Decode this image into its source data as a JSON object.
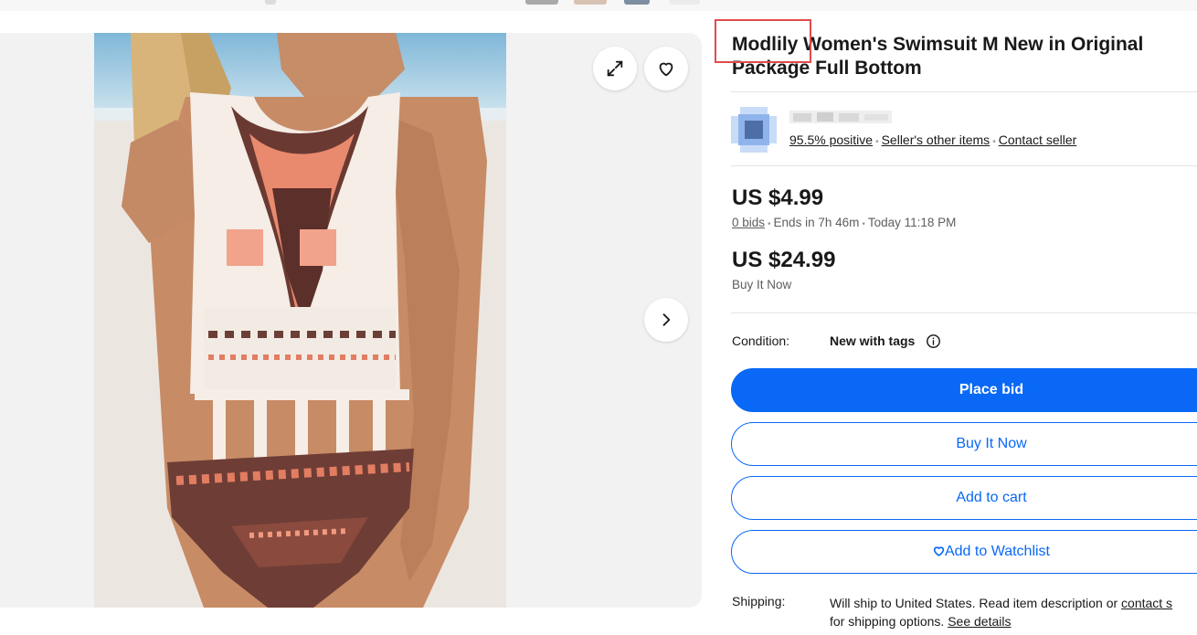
{
  "colors": {
    "primary": "#0968f6",
    "highlight_box": "#e04b4b",
    "gallery_bg": "#f2f2f2"
  },
  "gallery": {
    "expand_icon": "expand-icon",
    "favorite_icon": "heart-icon",
    "next_icon": "chevron-right-icon"
  },
  "listing": {
    "title": "Modlily Women's Swimsuit M New in Original Package Full Bottom"
  },
  "seller": {
    "feedback": "95.5% positive",
    "other_items": "Seller's other items",
    "contact": "Contact seller"
  },
  "auction": {
    "current_price": "US $4.99",
    "bids": "0 bids",
    "ends_in": "Ends in 7h 46m",
    "end_time": "Today 11:18 PM"
  },
  "buy_now": {
    "price": "US $24.99",
    "label": "Buy It Now"
  },
  "condition": {
    "label": "Condition:",
    "value": "New with tags"
  },
  "buttons": {
    "place_bid": "Place bid",
    "buy_it_now": "Buy It Now",
    "add_to_cart": "Add to cart",
    "add_to_watchlist": "Add to Watchlist"
  },
  "shipping": {
    "label": "Shipping:",
    "text_before": "Will ship to United States. Read item description or ",
    "contact_link": "contact s",
    "text_after": "for shipping options. ",
    "details_link": "See details"
  }
}
